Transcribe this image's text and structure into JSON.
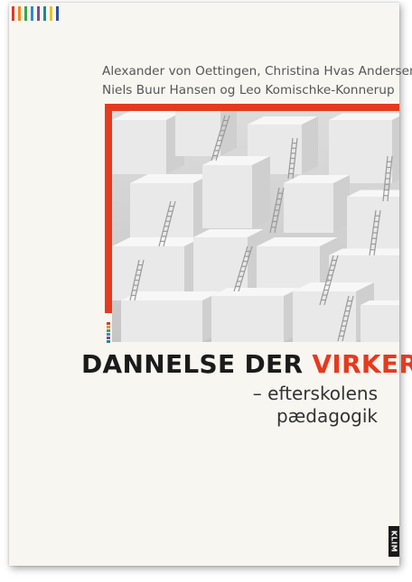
{
  "cover": {
    "authors_line1": "Alexander von Oettingen, Christina Hvas Andersen,",
    "authors_line2": "Niels Buur Hansen og Leo Komischke-Konnerup",
    "title_part1": "DANNELSE DER ",
    "title_part2": "VIRKER",
    "subtitle_line1": "– efterskolens",
    "subtitle_line2": "pædagogik",
    "publisher_logo": "KLIM",
    "colors": {
      "accent": "#e63a1e",
      "title_dark": "#1b1b1b",
      "background": "#f8f6f1",
      "stripes": [
        "#d93a2b",
        "#f08a1c",
        "#3aa64a",
        "#2d8bc9",
        "#7a4aa0",
        "#1c8a8a",
        "#e8c320",
        "#2a4f9e"
      ]
    }
  }
}
